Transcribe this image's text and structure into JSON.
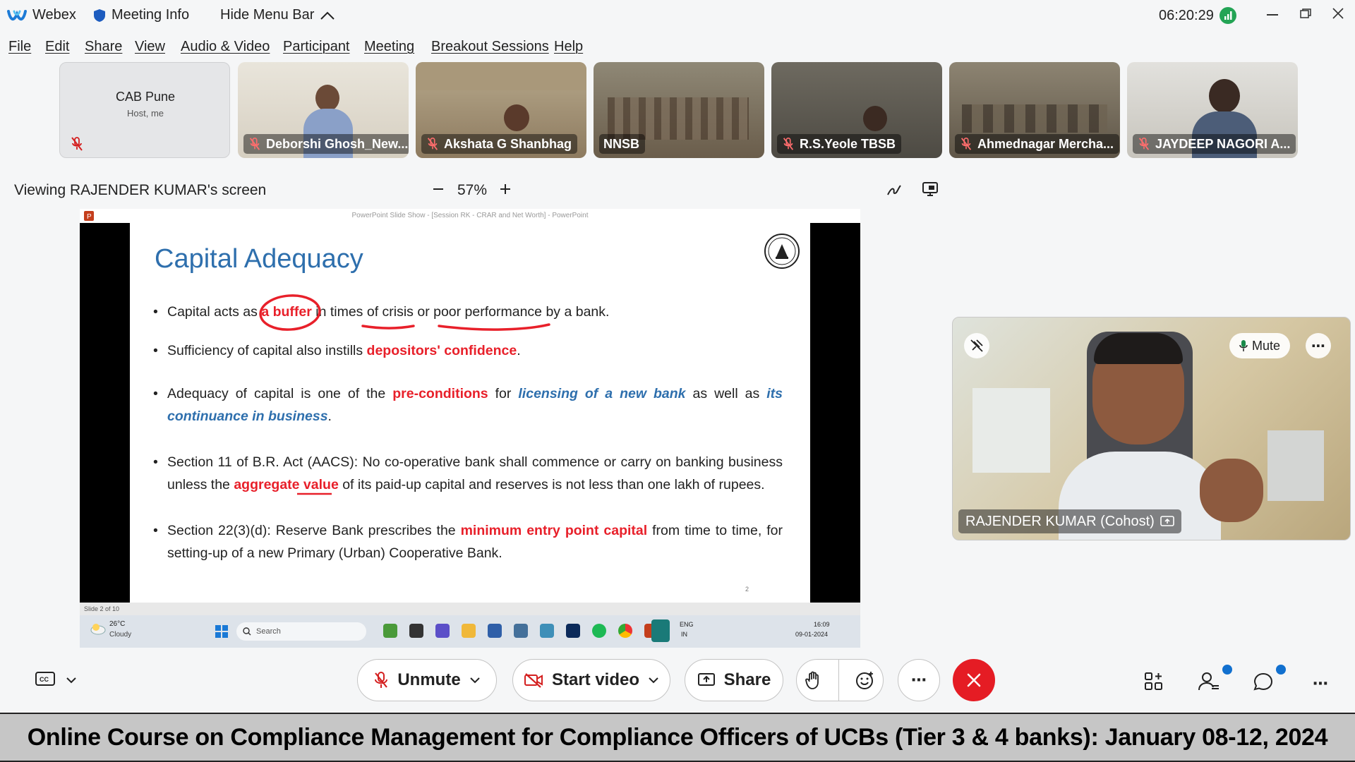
{
  "titlebar": {
    "app_name": "Webex",
    "meeting_info": "Meeting Info",
    "hide_menu_bar": "Hide Menu Bar",
    "clock": "06:20:29"
  },
  "menu": [
    "File",
    "Edit",
    "Share",
    "View",
    "Audio & Video",
    "Participant",
    "Meeting",
    "Breakout Sessions",
    "Help"
  ],
  "participants": {
    "me": {
      "name": "CAB Pune",
      "role": "Host, me"
    },
    "tiles": [
      {
        "name": "Deborshi Ghosh_New...",
        "muted": true
      },
      {
        "name": "Akshata G Shanbhag",
        "muted": true
      },
      {
        "name": "NNSB",
        "muted": false
      },
      {
        "name": "R.S.Yeole TBSB",
        "muted": true
      },
      {
        "name": "Ahmednagar Mercha...",
        "muted": true
      },
      {
        "name": "JAYDEEP NAGORI A...",
        "muted": true
      }
    ]
  },
  "share": {
    "viewing_label": "Viewing RAJENDER KUMAR's screen",
    "zoom": "57%",
    "ppt_window_title": "PowerPoint Slide Show - [Session RK - CRAR and Net Worth] - PowerPoint",
    "slide_status": "Slide 2 of 10",
    "page_number": "2"
  },
  "slide": {
    "title": "Capital Adequacy",
    "b1": {
      "p1": "Capital acts as ",
      "h1": "a buffer",
      "p2": " in times of crisis or poor performance by a bank."
    },
    "b2": {
      "p1": "Sufficiency of capital also instills ",
      "h1": "depositors' confidence",
      "p2": "."
    },
    "b3": {
      "p1": "Adequacy of capital is one of the ",
      "h1": "pre-conditions",
      "p2": " for ",
      "h2": "licensing of a new bank",
      "p3": " as well as ",
      "h3": "its continuance in business",
      "p4": "."
    },
    "b4": {
      "p1": "Section 11 of B.R. Act (AACS): No co-operative bank shall commence or carry on banking business unless the ",
      "h1": "aggregate value",
      "p2": " of its paid-up capital and reserves is not less than one lakh of rupees."
    },
    "b5": {
      "p1": "Section 22(3)(d): Reserve Bank prescribes the ",
      "h1": "minimum entry point capital",
      "p2": " from time to time, for setting-up of a new Primary (Urban) Cooperative Bank."
    }
  },
  "windows_taskbar": {
    "weather_temp": "26°C",
    "weather_desc": "Cloudy",
    "search": "Search",
    "lang1": "ENG",
    "lang2": "IN",
    "time": "16:09",
    "date": "09-01-2024"
  },
  "speaker": {
    "name": "RAJENDER KUMAR (Cohost)",
    "mute_label": "Mute"
  },
  "controls": {
    "unmute": "Unmute",
    "start_video": "Start video",
    "share": "Share"
  },
  "banner": "Online Course on Compliance Management for Compliance Officers of UCBs (Tier 3 & 4 banks): January 08-12, 2024",
  "colors": {
    "accent_red": "#e8202a",
    "slide_blue": "#2e6fad",
    "end_call": "#e51c24",
    "notify_blue": "#1170cf"
  }
}
